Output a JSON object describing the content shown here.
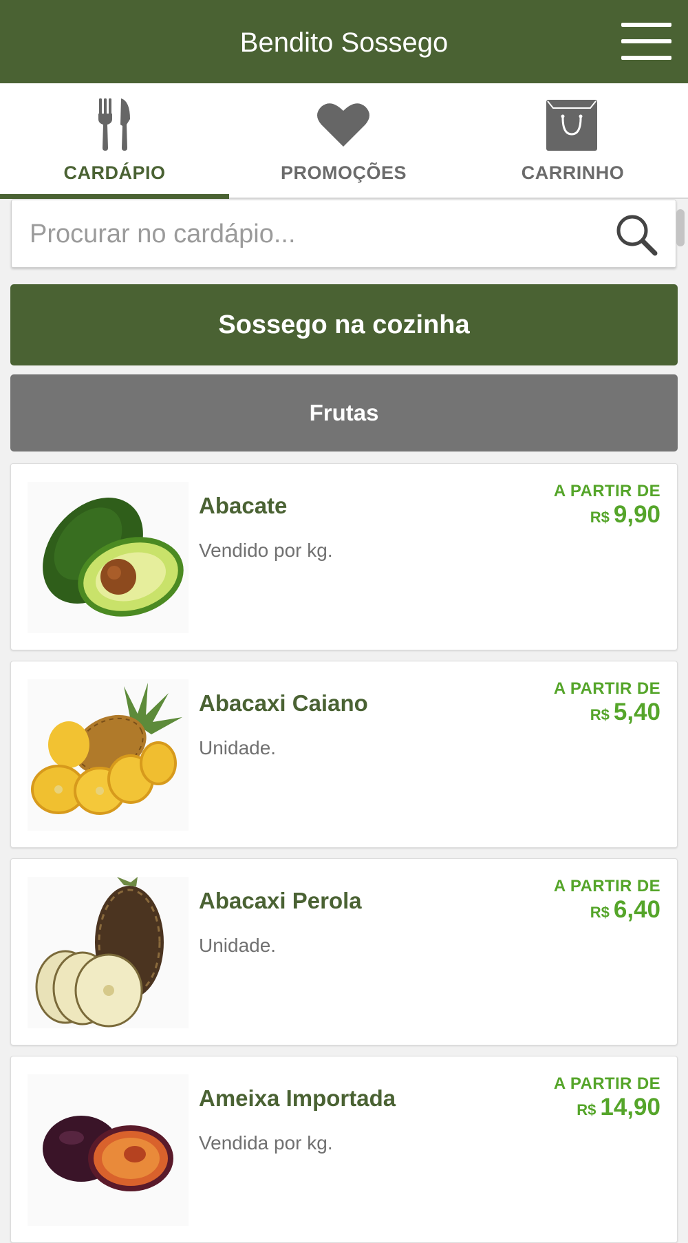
{
  "header": {
    "title": "Bendito Sossego"
  },
  "tabs": [
    {
      "label": "CARDÁPIO",
      "icon": "fork-knife-icon",
      "active": true
    },
    {
      "label": "PROMOÇÕES",
      "icon": "heart-icon",
      "active": false
    },
    {
      "label": "CARRINHO",
      "icon": "shopping-bag-icon",
      "active": false
    }
  ],
  "search": {
    "placeholder": "Procurar no cardápio...",
    "value": ""
  },
  "categories": [
    {
      "label": "Sossego na cozinha"
    },
    {
      "label": "Frutas"
    }
  ],
  "products": [
    {
      "name": "Abacate",
      "description": "Vendido por kg.",
      "price_label": "A PARTIR DE",
      "currency": "R$",
      "price": "9,90"
    },
    {
      "name": "Abacaxi Caiano",
      "description": "Unidade.",
      "price_label": "A PARTIR DE",
      "currency": "R$",
      "price": "5,40"
    },
    {
      "name": "Abacaxi Perola",
      "description": "Unidade.",
      "price_label": "A PARTIR DE",
      "currency": "R$",
      "price": "6,40"
    },
    {
      "name": "Ameixa Importada",
      "description": "Vendida por kg.",
      "price_label": "A PARTIR DE",
      "currency": "R$",
      "price": "14,90"
    }
  ],
  "colors": {
    "brand_green": "#4a6233",
    "price_green": "#55a52a",
    "category_gray": "#747474"
  }
}
